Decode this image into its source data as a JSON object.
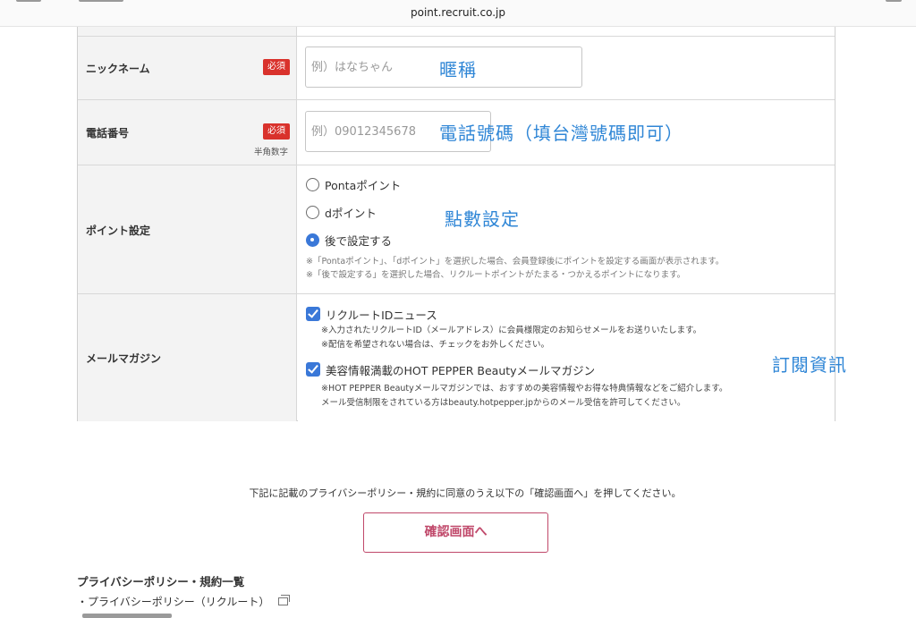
{
  "browser": {
    "url": "point.recruit.co.jp"
  },
  "form": {
    "nickname": {
      "label": "ニックネーム",
      "required": "必須",
      "placeholder": "例）はなちゃん",
      "annotation": "暱稱"
    },
    "phone": {
      "label": "電話番号",
      "required": "必須",
      "hint": "半角数字",
      "placeholder": "例）09012345678",
      "annotation": "電話號碼（填台灣號碼即可）"
    },
    "points": {
      "label": "ポイント設定",
      "annotation": "點數設定",
      "options": [
        {
          "label": "Pontaポイント",
          "selected": false
        },
        {
          "label": "dポイント",
          "selected": false
        },
        {
          "label": "後で設定する",
          "selected": true
        }
      ],
      "notes": [
        "※「Pontaポイント」、「dポイント」を選択した場合、会員登録後にポイントを設定する画面が表示されます。",
        "※「後で設定する」を選択した場合、リクルートポイントがたまる・つかえるポイントになります。"
      ]
    },
    "mail": {
      "label": "メールマガジン",
      "annotation": "訂閱資訊",
      "options": [
        {
          "label": "リクルートIDニュース",
          "checked": true,
          "notes": [
            "※入力されたリクルートID（メールアドレス）に会員様限定のお知らせメールをお送りいたします。",
            "※配信を希望されない場合は、チェックをお外しください。"
          ]
        },
        {
          "label": "美容情報満載のHOT PEPPER Beautyメールマガジン",
          "checked": true,
          "notes": [
            "※HOT PEPPER Beautyメールマガジンでは、おすすめの美容情報やお得な特典情報などをご紹介します。",
            "メール受信制限をされている方はbeauty.hotpepper.jpからのメール受信を許可してください。"
          ]
        }
      ]
    }
  },
  "consent": {
    "text": "下記に記載のプライバシーポリシー・規約に同意のうえ以下の「確認画面へ」を押してください。",
    "button": "確認画面へ"
  },
  "policy": {
    "heading": "プライバシーポリシー・規約一覧",
    "links": [
      "・プライバシーポリシー（リクルート）"
    ]
  },
  "icons": {
    "external": "external-link-icon"
  },
  "colors": {
    "required_badge": "#d9322c",
    "accent": "#3a78d8",
    "annotation": "#2f86d6",
    "button": "#c0486a"
  }
}
